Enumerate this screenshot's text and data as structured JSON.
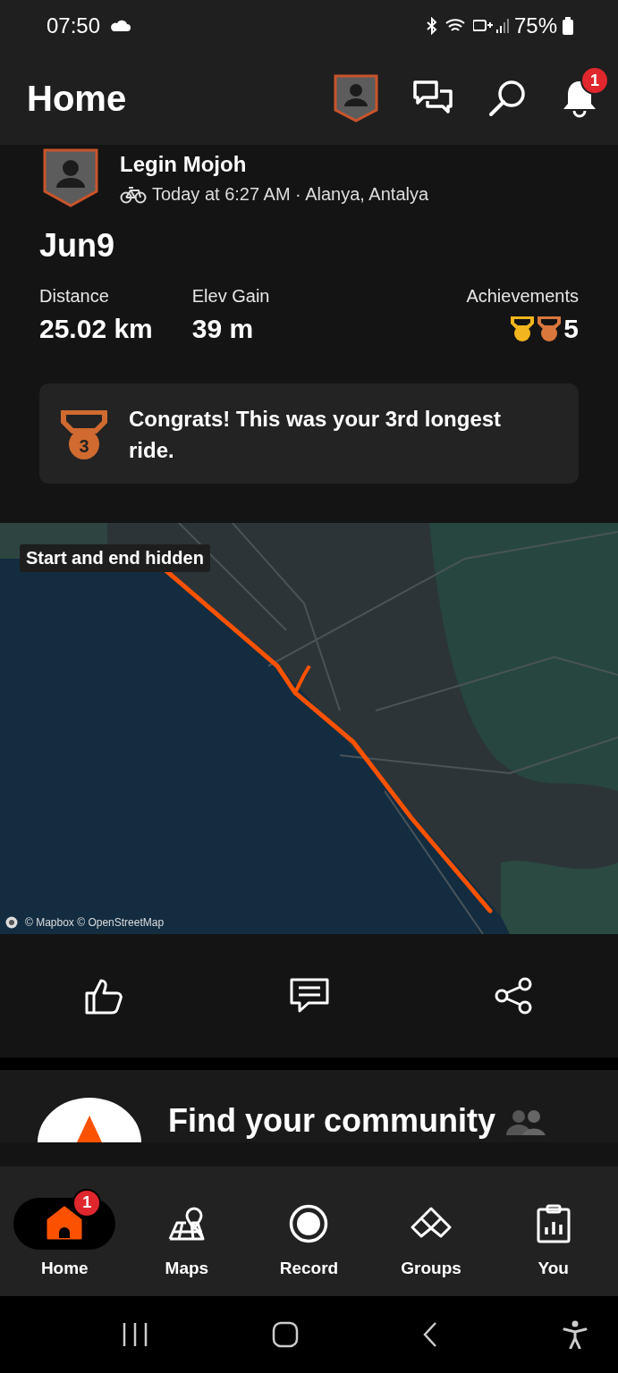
{
  "status_bar": {
    "time": "07:50",
    "battery": "75%"
  },
  "header": {
    "title": "Home",
    "notification_badge": "1"
  },
  "activity": {
    "athlete": "Legin Mojoh",
    "meta": "Today at 6:27 AM · Alanya, Antalya",
    "title": "Jun9",
    "stats": [
      {
        "label": "Distance",
        "value": "25.02 km"
      },
      {
        "label": "Elev Gain",
        "value": "39 m"
      }
    ],
    "achievements": {
      "label": "Achievements",
      "count": "5",
      "medals": [
        {
          "color": "#f2b51d"
        },
        {
          "color": "#d9773c"
        }
      ]
    },
    "congrats": {
      "medal_number": "3",
      "text": "Congrats! This was your 3rd longest ride."
    },
    "map": {
      "label": "Start and end hidden",
      "attribution": "© Mapbox © OpenStreetMap"
    }
  },
  "community": {
    "title": "Find your community"
  },
  "nav": [
    {
      "label": "Home",
      "selected": true,
      "badge": "1"
    },
    {
      "label": "Maps",
      "selected": false
    },
    {
      "label": "Record",
      "selected": false
    },
    {
      "label": "Groups",
      "selected": false
    },
    {
      "label": "You",
      "selected": false
    }
  ]
}
